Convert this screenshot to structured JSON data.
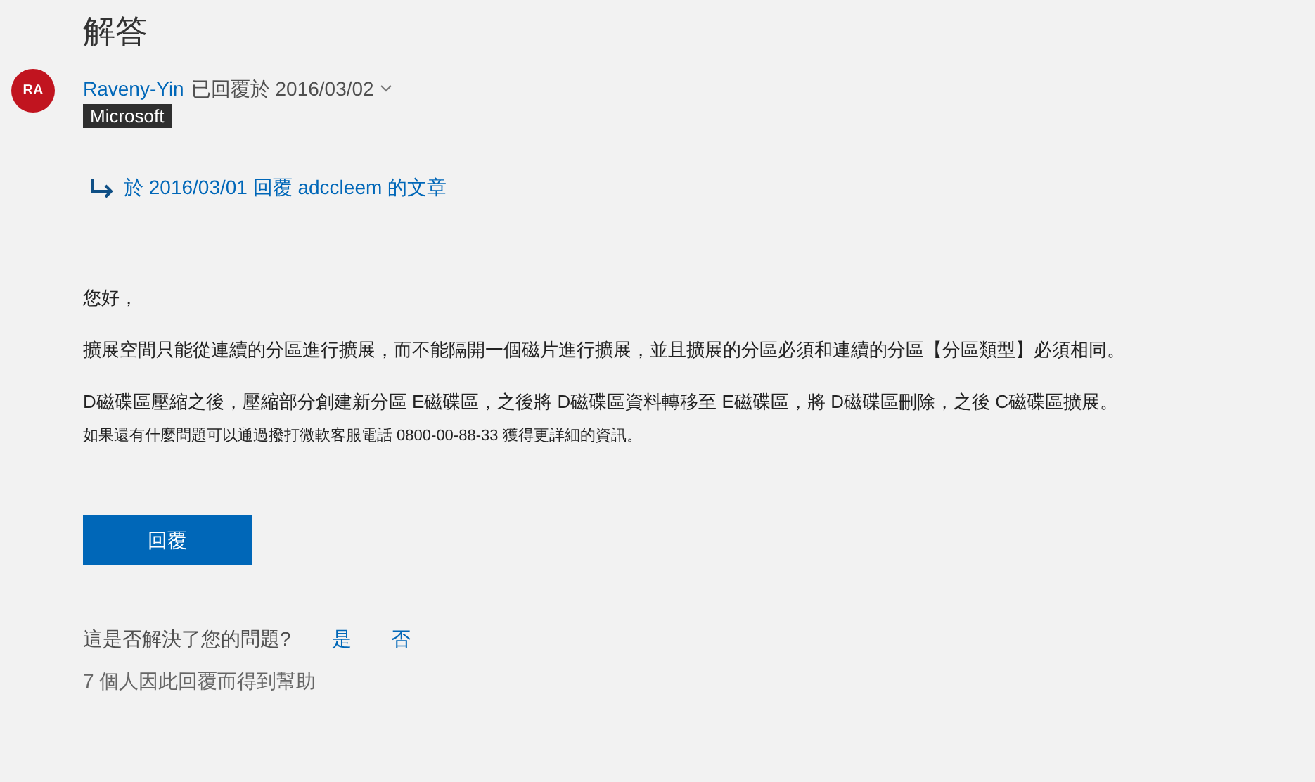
{
  "heading": "解答",
  "author": {
    "initials": "RA",
    "name": "Raveny-Yin",
    "replied": "已回覆於 2016/03/02",
    "badge": "Microsoft"
  },
  "in_reply_to": "於 2016/03/01 回覆 adccleem 的文章",
  "body": [
    "您好，",
    "擴展空間只能從連續的分區進行擴展，而不能隔開一個磁片進行擴展，並且擴展的分區必須和連續的分區【分區類型】必須相同。",
    "D磁碟區壓縮之後，壓縮部分創建新分區 E磁碟區，之後將 D磁碟區資料轉移至 E磁碟區，將 D磁碟區刪除，之後 C磁碟區擴展。"
  ],
  "footnote": "如果還有什麼問題可以通過撥打微軟客服電話 0800-00-88-33 獲得更詳細的資訊。",
  "reply_button": "回覆",
  "feedback": {
    "question": "這是否解決了您的問題?",
    "yes": "是",
    "no": "否",
    "helped": "7 個人因此回覆而得到幫助"
  }
}
